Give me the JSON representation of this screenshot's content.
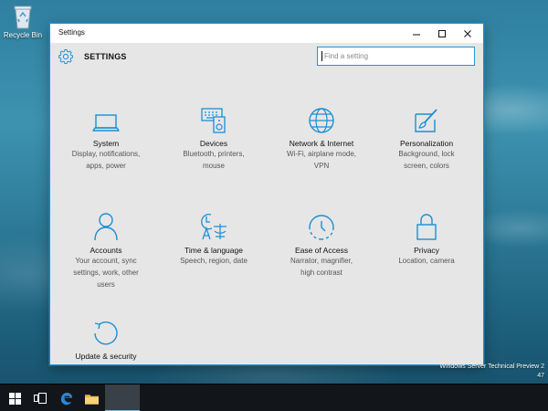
{
  "desktop": {
    "recycle_bin_label": "Recycle Bin",
    "watermark_line1": "Windows Server Technical Preview 2",
    "watermark_line2": "47"
  },
  "window": {
    "title": "Settings",
    "header_title": "SETTINGS",
    "search_placeholder": "Find a setting",
    "accent_color": "#1a8fd6"
  },
  "tiles": [
    {
      "icon": "laptop-icon",
      "name": "System",
      "desc1": "Display, notifications,",
      "desc2": "apps, power",
      "desc3": ""
    },
    {
      "icon": "devices-icon",
      "name": "Devices",
      "desc1": "Bluetooth, printers,",
      "desc2": "mouse",
      "desc3": ""
    },
    {
      "icon": "globe-icon",
      "name": "Network & Internet",
      "desc1": "Wi-Fi, airplane mode,",
      "desc2": "VPN",
      "desc3": ""
    },
    {
      "icon": "paint-icon",
      "name": "Personalization",
      "desc1": "Background, lock",
      "desc2": "screen, colors",
      "desc3": ""
    },
    {
      "icon": "person-icon",
      "name": "Accounts",
      "desc1": "Your account, sync",
      "desc2": "settings, work, other",
      "desc3": "users"
    },
    {
      "icon": "time-language-icon",
      "name": "Time & language",
      "desc1": "Speech, region, date",
      "desc2": "",
      "desc3": ""
    },
    {
      "icon": "ease-of-access-icon",
      "name": "Ease of Access",
      "desc1": "Narrator, magnifier,",
      "desc2": "high contrast",
      "desc3": ""
    },
    {
      "icon": "lock-icon",
      "name": "Privacy",
      "desc1": "Location, camera",
      "desc2": "",
      "desc3": ""
    },
    {
      "icon": "update-icon",
      "name": "Update & security",
      "desc1": "",
      "desc2": "",
      "desc3": ""
    }
  ],
  "taskbar": {
    "items": [
      "start",
      "task-view",
      "edge",
      "file-explorer",
      "settings-app"
    ]
  }
}
